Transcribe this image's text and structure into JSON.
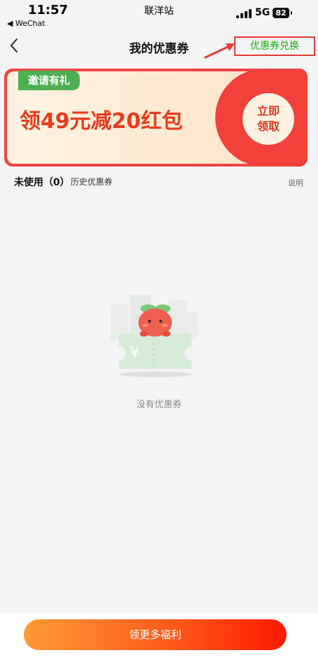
{
  "status": {
    "time": "11:57",
    "back_app": "◀ WeChat",
    "carrier": "联洋站",
    "network": "5G",
    "battery": "82"
  },
  "nav": {
    "title": "我的优惠券",
    "exchange_label": "优惠券兑换"
  },
  "banner": {
    "tag": "邀请有礼",
    "text": "领49元减20红包",
    "claim_label": "立即领取"
  },
  "tabs": {
    "unused": "未使用（0）",
    "history": "历史优惠券",
    "explain": "说明"
  },
  "empty": {
    "text": "没有优惠券"
  },
  "bottom": {
    "button_label": "领更多福利"
  },
  "colors": {
    "accent_green": "#1aad19",
    "highlight_red": "#e53935",
    "banner_red": "#ee4643"
  }
}
